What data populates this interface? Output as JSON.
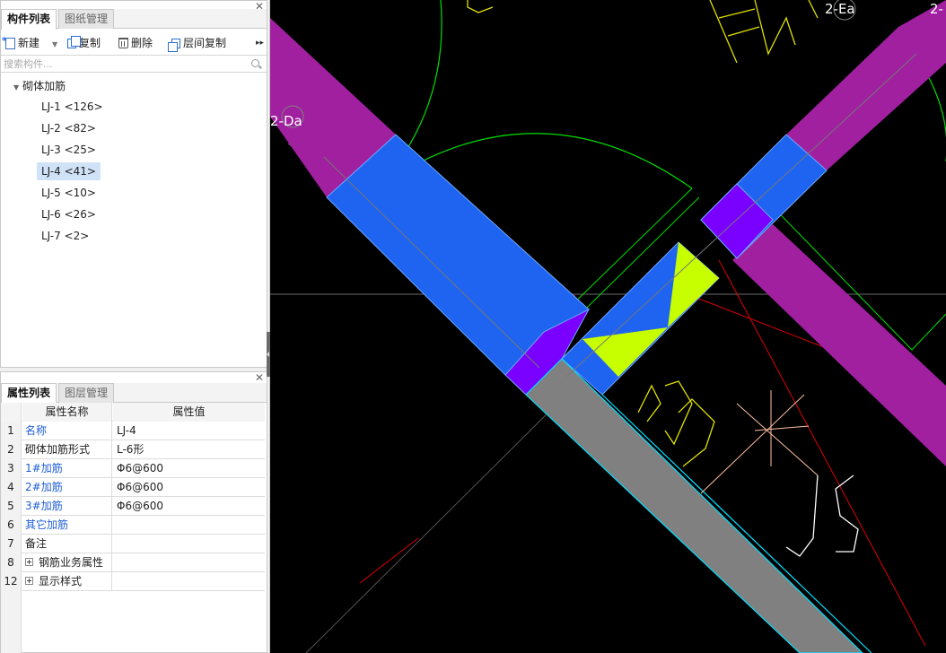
{
  "component_panel": {
    "tabs": [
      "构件列表",
      "图纸管理"
    ],
    "toolbar": {
      "new": "新建",
      "copy": "复制",
      "delete": "删除",
      "floor_copy": "层间复制"
    },
    "search_placeholder": "搜索构件...",
    "tree_root": "砌体加筋",
    "items": [
      "LJ-1 <126>",
      "LJ-2 <82>",
      "LJ-3 <25>",
      "LJ-4 <41>",
      "LJ-5 <10>",
      "LJ-6 <26>",
      "LJ-7 <2>"
    ],
    "selected": "LJ-4 <41>"
  },
  "property_panel": {
    "tabs": [
      "属性列表",
      "图层管理"
    ],
    "header": {
      "name": "属性名称",
      "value": "属性值"
    },
    "rows": [
      {
        "idx": "1",
        "name": "名称",
        "value": "LJ-4"
      },
      {
        "idx": "2",
        "name": "砌体加筋形式",
        "value": "L-6形"
      },
      {
        "idx": "3",
        "name": "1#加筋",
        "value": "Φ6@600"
      },
      {
        "idx": "4",
        "name": "2#加筋",
        "value": "Φ6@600"
      },
      {
        "idx": "5",
        "name": "3#加筋",
        "value": "Φ6@600"
      },
      {
        "idx": "6",
        "name": "其它加筋",
        "value": ""
      },
      {
        "idx": "7",
        "name": "备注",
        "value": ""
      },
      {
        "idx": "8",
        "name": "钢筋业务属性",
        "value": ""
      },
      {
        "idx": "12",
        "name": "显示样式",
        "value": ""
      }
    ]
  },
  "canvas": {
    "labels": {
      "axis_da": "2-Da",
      "axis_ea": "2-Ea",
      "axis_right": "2-"
    },
    "colors": {
      "wall": "#a020a0",
      "component": "#1e64f0",
      "joint": "#7a00ff",
      "rebar": "#c8ff00",
      "gray_wall": "#808080",
      "outline": "#00e0ff",
      "background": "#000000"
    }
  }
}
